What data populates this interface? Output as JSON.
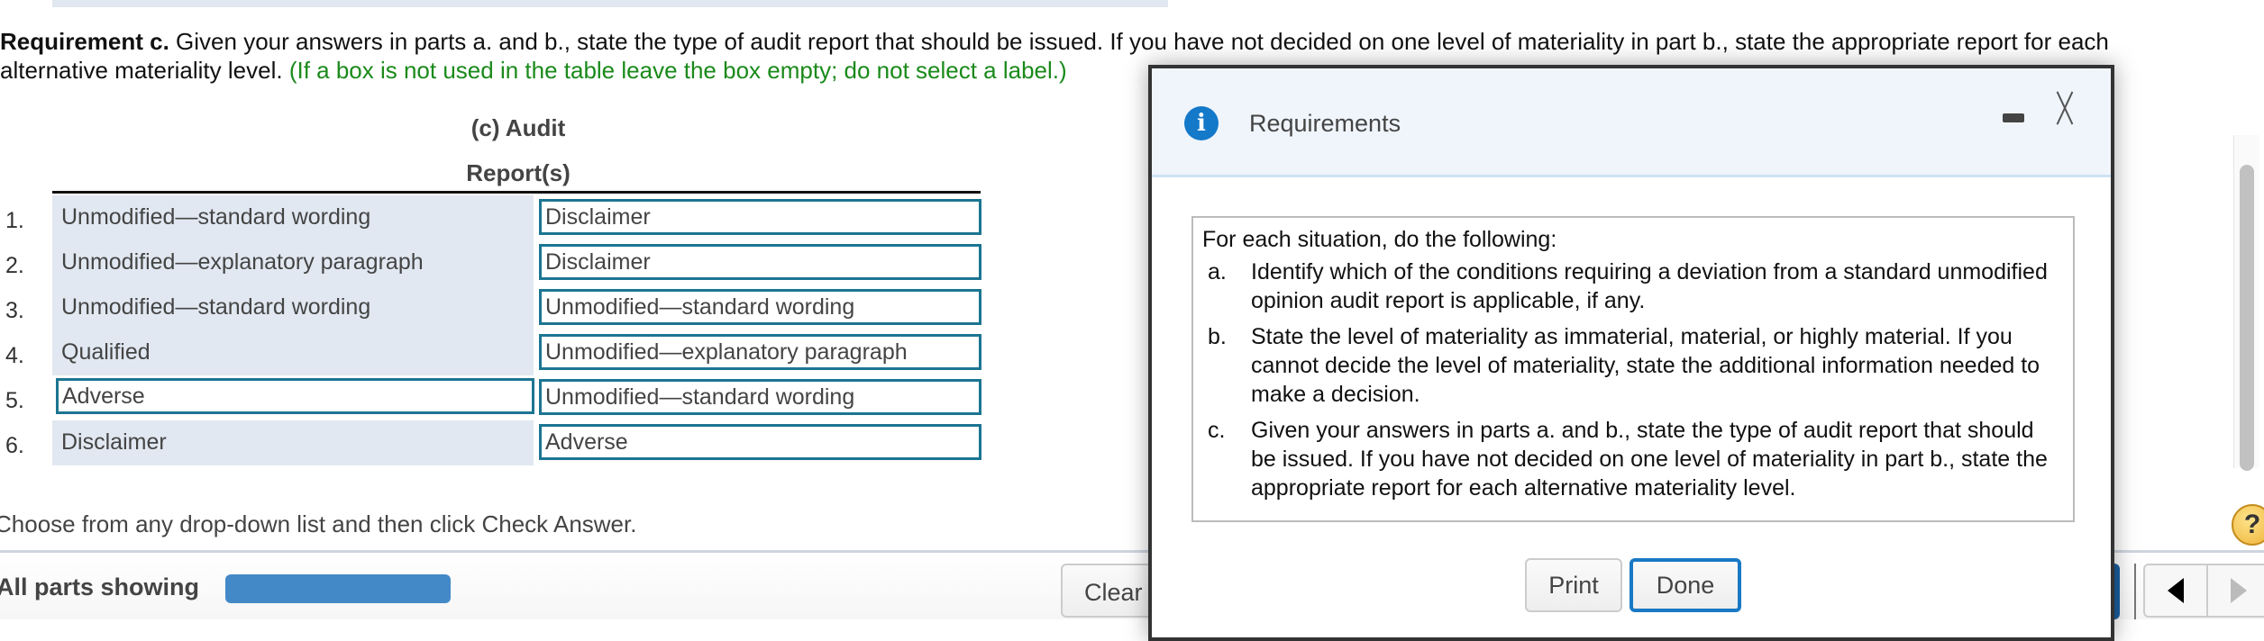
{
  "requirement": {
    "label": "Requirement c.",
    "line1_rest": " Given your answers in parts a. and b., state the type of audit report that should be issued. If you have not decided on one level of materiality in part b., state the appropriate report for each",
    "line2": "alternative materiality level. ",
    "note": "(If a box is not used in the table leave the box empty; do not select a label.)"
  },
  "table": {
    "header_line1": "(c) Audit",
    "header_line2": "Report(s)",
    "rows": [
      {
        "number": "1.",
        "left": "Unmodified—standard wording",
        "left_is_dropdown": false,
        "right": "Disclaimer"
      },
      {
        "number": "2.",
        "left": "Unmodified—explanatory paragraph",
        "left_is_dropdown": false,
        "right": "Disclaimer"
      },
      {
        "number": "3.",
        "left": "Unmodified—standard wording",
        "left_is_dropdown": false,
        "right": "Unmodified—standard wording"
      },
      {
        "number": "4.",
        "left": "Qualified",
        "left_is_dropdown": false,
        "right": "Unmodified—explanatory paragraph"
      },
      {
        "number": "5.",
        "left": "Adverse",
        "left_is_dropdown": true,
        "right": "Unmodified—standard wording"
      },
      {
        "number": "6.",
        "left": "Disclaimer",
        "left_is_dropdown": false,
        "right": "Adverse"
      }
    ]
  },
  "instructions": "Choose from any drop-down list and then click Check Answer.",
  "footer": {
    "parts_label": "All parts showing",
    "clear_label": "Clear",
    "help_icon": "?"
  },
  "modal": {
    "title": "Requirements",
    "info_icon": "i",
    "intro": "For each situation, do the following:",
    "items": [
      {
        "letter": "a.",
        "text": "Identify which of the conditions requiring a deviation from a standard unmodified opinion audit report is applicable, if any."
      },
      {
        "letter": "b.",
        "text": "State the level of materiality as immaterial, material, or highly material. If you cannot decide the level of materiality, state the additional information needed to make a decision."
      },
      {
        "letter": "c.",
        "text": "Given your answers in parts a. and b., state the type of audit report that should be issued. If you have not decided on one level of materiality in part b., state the appropriate report for each alternative materiality level."
      }
    ],
    "print_label": "Print",
    "done_label": "Done"
  },
  "colors": {
    "accent_blue": "#1a79c4",
    "dropdown_border": "#1c7592",
    "note_green": "#1a8a1a",
    "cell_bg": "#e1e8f1"
  }
}
